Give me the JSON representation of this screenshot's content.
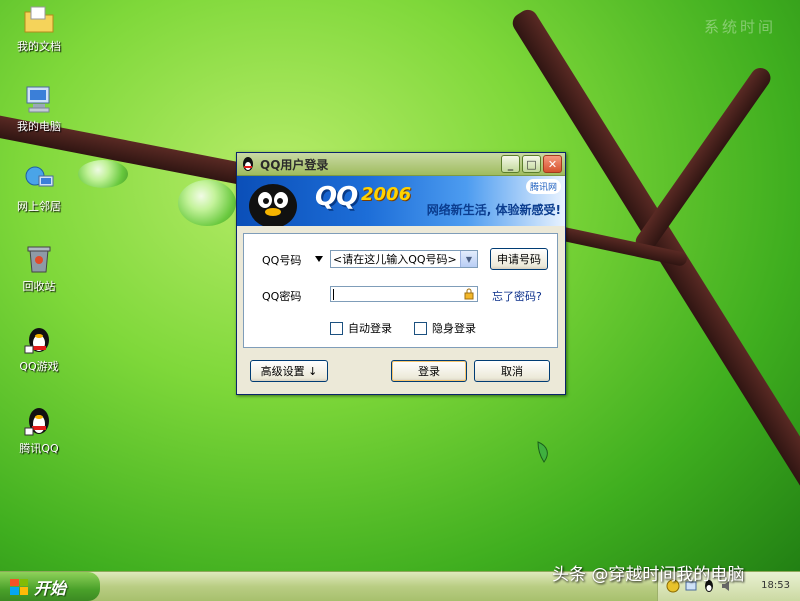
{
  "desktop": {
    "watermark": "系统时间",
    "icons": [
      {
        "label": "我的文档",
        "icon": "documents-folder-icon"
      },
      {
        "label": "我的电脑",
        "icon": "computer-icon"
      },
      {
        "label": "网上邻居",
        "icon": "network-icon"
      },
      {
        "label": "回收站",
        "icon": "recycle-bin-icon"
      },
      {
        "label": "QQ游戏",
        "icon": "qq-game-icon"
      },
      {
        "label": "腾讯QQ",
        "icon": "qq-penguin-icon"
      }
    ]
  },
  "window": {
    "title": "QQ用户登录",
    "banner": {
      "logo": "QQ",
      "year": "2006",
      "slogan": "网络新生活, 体验新感受!",
      "badge": "腾讯网"
    },
    "account": {
      "label": "QQ号码",
      "placeholder": "<请在这儿输入QQ号码>",
      "apply_button": "申请号码"
    },
    "password": {
      "label": "QQ密码",
      "forgot_link": "忘了密码?"
    },
    "options": {
      "auto_login": "自动登录",
      "invisible_login": "隐身登录"
    },
    "buttons": {
      "advanced": "高级设置 ↓",
      "login": "登录",
      "cancel": "取消"
    }
  },
  "taskbar": {
    "start_label": "开始",
    "clock": "18:53"
  },
  "watermark_bottom": "头条 @穿越时间我的电脑",
  "colors": {
    "title_bar": "#9fbc5e",
    "banner_blue": "#1d6ed8",
    "start_green": "#4aa12a"
  }
}
